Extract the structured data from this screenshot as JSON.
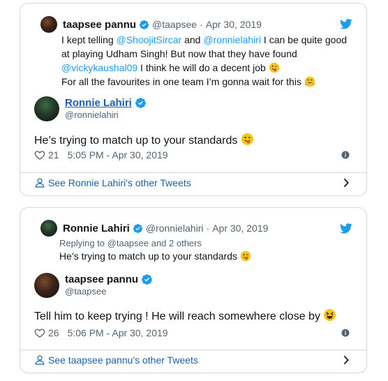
{
  "card1": {
    "quoted": {
      "name": "taapsee pannu",
      "handle": "@taapsee",
      "date": "Apr 30, 2019",
      "lines": {
        "l1_a": "I kept telling ",
        "l1_m1": "@ShoojitSircar",
        "l1_b": " and ",
        "l1_m2": "@ronnielahiri",
        "l1_c": " I can be quite good",
        "l2": "at playing Udham Singh! But now that they have found",
        "l3_m": "@vickykaushal09",
        "l3_b": " I think he will do a decent job",
        "l4": "For all the favourites in one team I’m gonna wait for this"
      }
    },
    "author": {
      "name": "Ronnie Lahiri",
      "handle": "@ronnielahiri"
    },
    "text": "He’s trying to match up to your standards",
    "likes": "21",
    "timestamp": "5:05 PM - Apr 30, 2019",
    "footer": "See Ronnie Lahiri's other Tweets"
  },
  "card2": {
    "quoted": {
      "name": "Ronnie Lahiri",
      "handle": "@ronnielahiri",
      "date": "Apr 30, 2019",
      "replying": "Replying to @taapsee and 2 others",
      "text": "He’s trying to match up to your standards"
    },
    "author": {
      "name": "taapsee pannu",
      "handle": "@taapsee"
    },
    "text": "Tell him to keep trying ! He will reach somewhere close by",
    "likes": "26",
    "timestamp": "5:06 PM - Apr 30, 2019",
    "footer": "See taapsee pannu's other Tweets"
  },
  "colors": {
    "link": "#1d9bf0",
    "verified": "#1d9bf0",
    "muted": "#536471",
    "border": "#cfd9de"
  },
  "icons": [
    "twitter-bird-icon",
    "verified-badge-icon",
    "heart-icon",
    "info-icon",
    "person-icon",
    "chevron-right-icon",
    "winking-tongue-emoji",
    "hugging-emoji",
    "squinting-laugh-emoji"
  ]
}
